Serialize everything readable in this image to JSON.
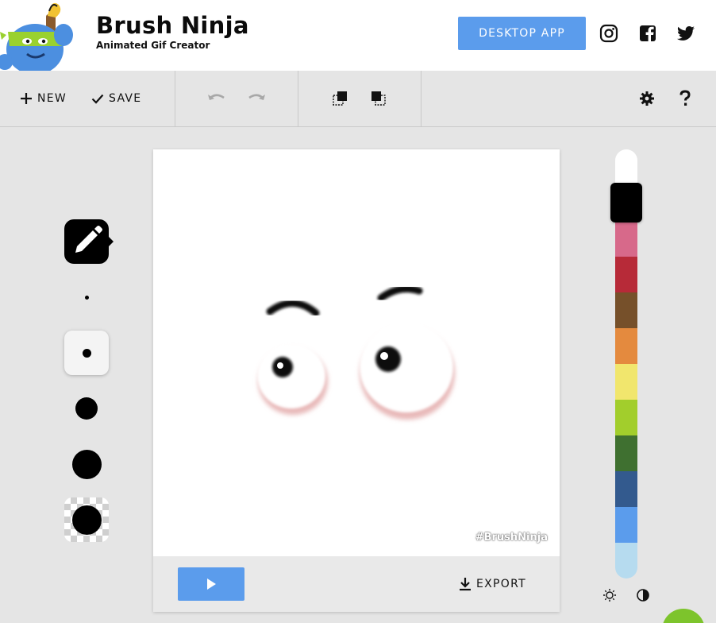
{
  "header": {
    "title": "Brush Ninja",
    "subtitle": "Animated Gif Creator",
    "desktop_app_label": "DESKTOP APP",
    "social": [
      "instagram-icon",
      "facebook-icon",
      "twitter-icon"
    ]
  },
  "toolbar": {
    "new_label": "NEW",
    "save_label": "SAVE",
    "icons": [
      "undo-icon",
      "redo-icon",
      "copy-frame-icon",
      "duplicate-frame-icon",
      "settings-icon",
      "help-icon"
    ]
  },
  "brushes": {
    "tool": "pencil-icon",
    "sizes": [
      "extra-small",
      "small",
      "medium",
      "large",
      "extra-large"
    ],
    "selected": "small"
  },
  "canvas": {
    "watermark": "#BrushNinja",
    "export_label": "EXPORT"
  },
  "palette": {
    "colors": [
      "#ffffff",
      "#000000",
      "#d7698a",
      "#b72a38",
      "#76502a",
      "#e48a3e",
      "#f1e66d",
      "#a2ce2c",
      "#3f7030",
      "#335a8e",
      "#5b9cec",
      "#b6dbef"
    ],
    "selected": "#000000",
    "modes": [
      "brightness-icon",
      "contrast-icon"
    ]
  },
  "colors": {
    "accent": "#5b9cec",
    "background": "#e5e5e5",
    "help_fab": "#7dc42c"
  }
}
